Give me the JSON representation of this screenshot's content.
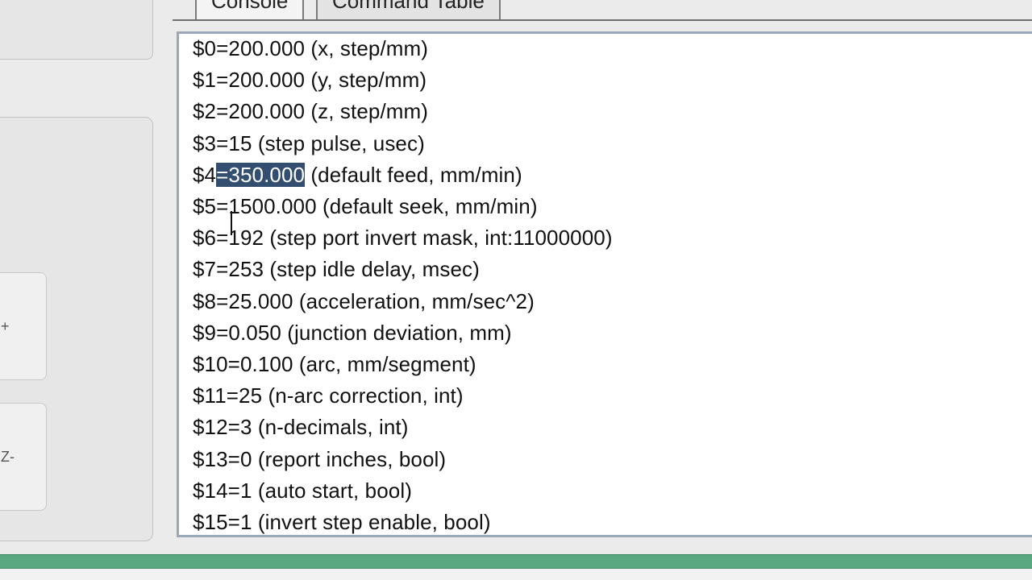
{
  "tabs": [
    {
      "label": "Console"
    },
    {
      "label": "Command Table"
    }
  ],
  "jog": {
    "plus_label": "+",
    "minus_label": "Z-"
  },
  "console": {
    "lines": [
      {
        "pre": "$0=200.000 (x, step/mm)",
        "sel": "",
        "post": ""
      },
      {
        "pre": "$1=200.000 (y, step/mm)",
        "sel": "",
        "post": ""
      },
      {
        "pre": "$2=200.000 (z, step/mm)",
        "sel": "",
        "post": ""
      },
      {
        "pre": "$3=15 (step pulse, usec)",
        "sel": "",
        "post": ""
      },
      {
        "pre": "$4",
        "sel": "=350.000",
        "post": " (default feed, mm/min)"
      },
      {
        "pre": "$5=1500.000 (default seek, mm/min)",
        "sel": "",
        "post": ""
      },
      {
        "pre": "$6=192 (step port invert mask, int:11000000)",
        "sel": "",
        "post": ""
      },
      {
        "pre": "$7=253 (step idle delay, msec)",
        "sel": "",
        "post": ""
      },
      {
        "pre": "$8=25.000 (acceleration, mm/sec^2)",
        "sel": "",
        "post": ""
      },
      {
        "pre": "$9=0.050 (junction deviation, mm)",
        "sel": "",
        "post": ""
      },
      {
        "pre": "$10=0.100 (arc, mm/segment)",
        "sel": "",
        "post": ""
      },
      {
        "pre": "$11=25 (n-arc correction, int)",
        "sel": "",
        "post": ""
      },
      {
        "pre": "$12=3 (n-decimals, int)",
        "sel": "",
        "post": ""
      },
      {
        "pre": "$13=0 (report inches, bool)",
        "sel": "",
        "post": ""
      },
      {
        "pre": "$14=1 (auto start, bool)",
        "sel": "",
        "post": ""
      },
      {
        "pre": "$15=1 (invert step enable, bool)",
        "sel": "",
        "post": ""
      }
    ]
  },
  "colors": {
    "selection": "#334e6e",
    "status_bar": "#5aa882",
    "console_border": "#9aa7b6"
  }
}
